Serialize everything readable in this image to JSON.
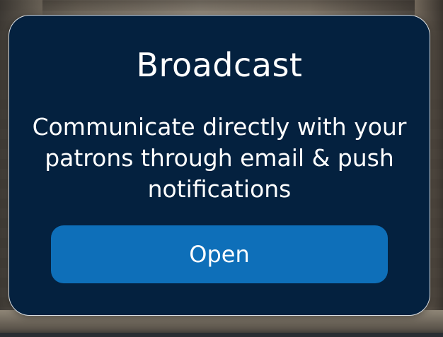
{
  "popup": {
    "title": "Broadcast",
    "description": "Communicate directly with your patrons through email & push notifications",
    "button_label": "Open"
  },
  "colors": {
    "card_background": "#04213f",
    "card_border": "#ffffff",
    "button_background": "#0e6fb9",
    "text": "#ffffff"
  }
}
